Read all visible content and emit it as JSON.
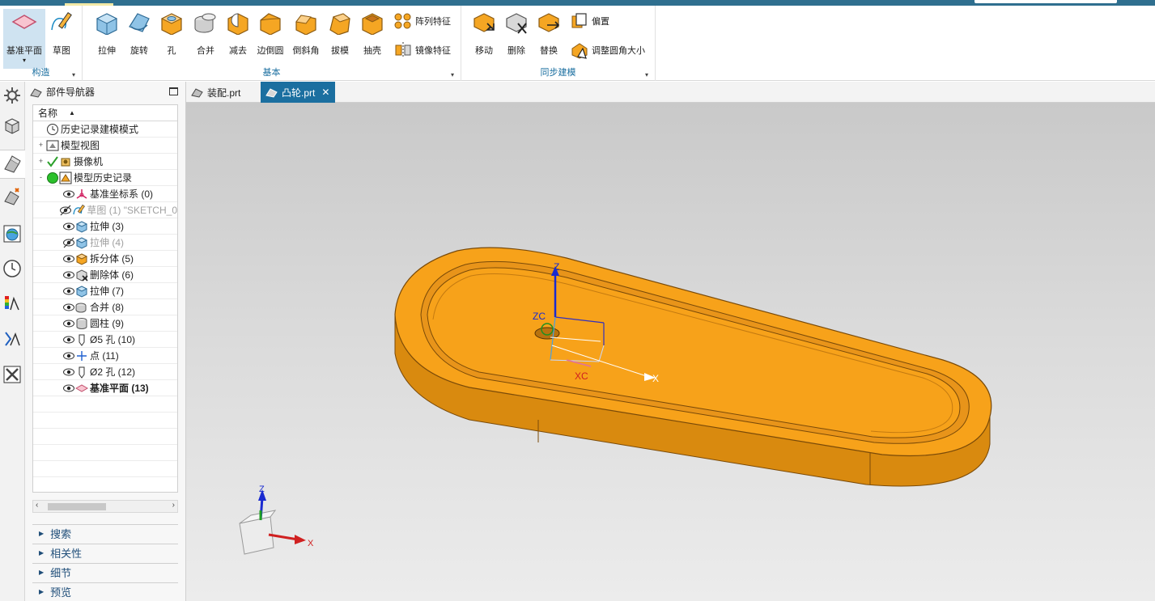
{
  "ribbon": {
    "construct": {
      "datum_plane": "基准平面",
      "sketch": "草图",
      "group_label": "构造"
    },
    "basic": {
      "extrude": "拉伸",
      "revolve": "旋转",
      "hole": "孔",
      "unite": "合并",
      "subtract": "减去",
      "edge_blend": "边倒圆",
      "chamfer": "倒斜角",
      "draft": "拔模",
      "shell": "抽壳",
      "pattern_feature": "阵列特征",
      "mirror_feature": "镜像特征",
      "group_label": "基本"
    },
    "sync": {
      "move": "移动",
      "delete": "删除",
      "replace": "替换",
      "offset": "偏置",
      "resize_blend": "调整圆角大小",
      "group_label": "同步建模"
    }
  },
  "navigator": {
    "title": "部件导航器",
    "column_name": "名称",
    "rows": [
      {
        "label": "历史记录建模模式",
        "icon": "clock-icon",
        "indent": 1
      },
      {
        "label": "模型视图",
        "icon": "model-views-icon",
        "indent": 1,
        "expander": "+"
      },
      {
        "label": "摄像机",
        "icon": "camera-icon",
        "indent": 1,
        "expander": "+",
        "check": true
      },
      {
        "label": "模型历史记录",
        "icon": "history-icon",
        "indent": 1,
        "expander": "-",
        "status": true
      },
      {
        "label": "基准坐标系 (0)",
        "icon": "datum-csys-icon",
        "indent": 2
      },
      {
        "label": "草图 (1) \"SKETCH_0",
        "icon": "sketch-icon",
        "indent": 2,
        "dim": true
      },
      {
        "label": "拉伸 (3)",
        "icon": "extrude-icon",
        "indent": 2
      },
      {
        "label": "拉伸 (4)",
        "icon": "extrude-icon",
        "indent": 2,
        "dim": true
      },
      {
        "label": "拆分体 (5)",
        "icon": "split-body-icon",
        "indent": 2
      },
      {
        "label": "删除体 (6)",
        "icon": "delete-body-icon",
        "indent": 2
      },
      {
        "label": "拉伸 (7)",
        "icon": "extrude-icon",
        "indent": 2
      },
      {
        "label": "合并 (8)",
        "icon": "unite-icon",
        "indent": 2
      },
      {
        "label": "圆柱 (9)",
        "icon": "cylinder-icon",
        "indent": 2
      },
      {
        "label": "Ø5 孔 (10)",
        "icon": "hole-icon",
        "indent": 2
      },
      {
        "label": "点 (11)",
        "icon": "point-icon",
        "indent": 2
      },
      {
        "label": "Ø2 孔 (12)",
        "icon": "hole-icon",
        "indent": 2
      },
      {
        "label": "基准平面 (13)",
        "icon": "datum-plane-icon",
        "indent": 2,
        "bold": true
      }
    ],
    "sections": [
      "搜索",
      "相关性",
      "细节",
      "预览"
    ]
  },
  "tabs": [
    {
      "label": "装配.prt",
      "active": false
    },
    {
      "label": "凸轮.prt",
      "active": true
    }
  ],
  "viewport": {
    "wcs_labels": {
      "z": "Z",
      "zc": "ZC",
      "xc": "XC",
      "x": "X"
    },
    "triad_labels": {
      "z": "Z",
      "x": "X"
    },
    "part_color": "#f7a21a"
  },
  "colors": {
    "accent": "#1b6fa0",
    "title_strip": "#2f6f8f",
    "orange": "#f7a21a"
  }
}
